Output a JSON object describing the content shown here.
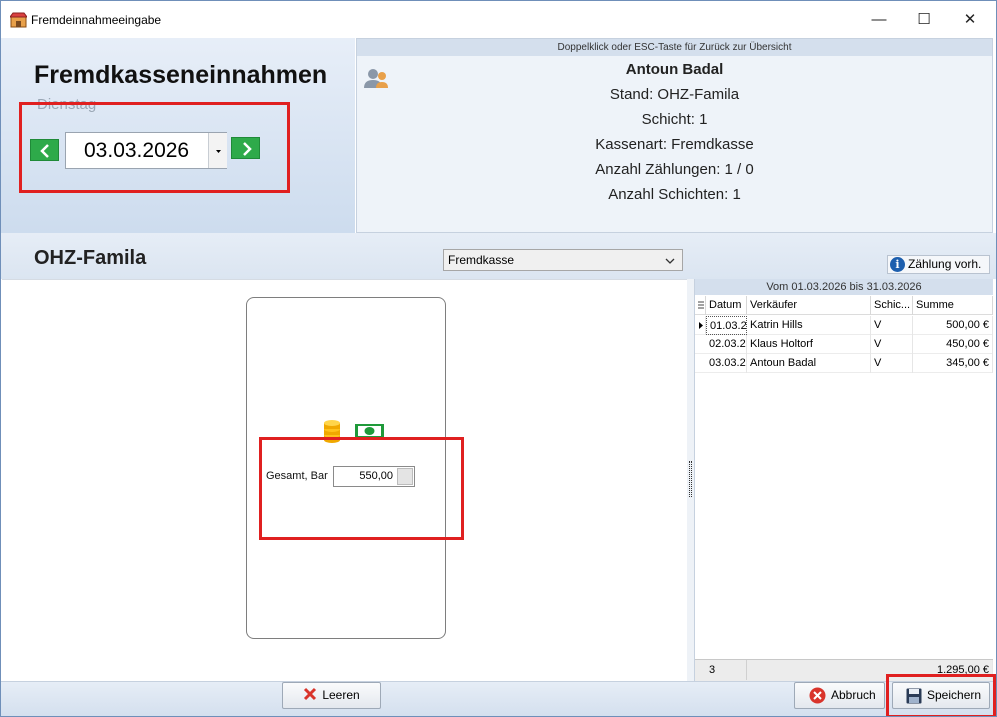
{
  "window": {
    "title": "Fremdeinnahmeeingabe",
    "minimize_glyph": "—",
    "maximize_glyph": "☐",
    "close_glyph": "✕"
  },
  "header": {
    "title": "Fremdkasseneinnahmen",
    "weekday": "Dienstag",
    "date": "03.03.2026",
    "prev_glyph": "<",
    "next_glyph": ">"
  },
  "info": {
    "hint": "Doppelklick oder ESC-Taste für Zurück zur Übersicht",
    "user_name": "Antoun  Badal",
    "stand": "Stand:  OHZ-Famila",
    "schicht": "Schicht:  1",
    "kassenart": "Kassenart:  Fremdkasse",
    "anzahl_zaehlungen": "Anzahl Zählungen:  1 / 0",
    "anzahl_schichten": "Anzahl Schichten:  1"
  },
  "section": {
    "location": "OHZ-Famila",
    "select_value": "Fremdkasse",
    "count_button": "Zählung vorh."
  },
  "entry": {
    "label": "Gesamt, Bar",
    "value": "550,00"
  },
  "grid": {
    "period": "Vom 01.03.2026 bis 31.03.2026",
    "headers": [
      "Datum",
      "Verkäufer",
      "Schic...",
      "Summe"
    ],
    "rows": [
      [
        "01.03.2",
        "Katrin Hills",
        "V",
        "500,00 €"
      ],
      [
        "02.03.2",
        "Klaus Holtorf",
        "V",
        "450,00 €"
      ],
      [
        "03.03.2",
        "Antoun Badal",
        "V",
        "345,00 €"
      ]
    ],
    "row_count": "3",
    "total": "1.295,00 €"
  },
  "buttons": {
    "clear": "Leeren",
    "cancel": "Abbruch",
    "save": "Speichern"
  },
  "colors": {
    "accent_green": "#2eaa4a",
    "highlight_red": "#e02020",
    "header_blue": "#d4dfed"
  }
}
